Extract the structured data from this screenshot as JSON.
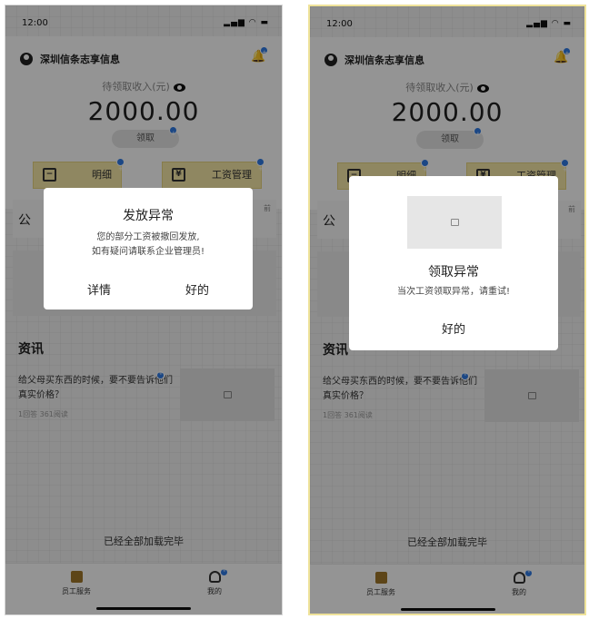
{
  "status": {
    "time": "12:00",
    "signal": "▂▄▆ ◠ ▬"
  },
  "header": {
    "company": "深圳信条志享信息",
    "income_label": "待领取收入(元)",
    "amount": "2000.00",
    "claim_button": "领取"
  },
  "actions": {
    "detail": "明细",
    "detail_icon": "−",
    "salary": "工资管理",
    "salary_icon": "¥"
  },
  "notice": {
    "label": "公",
    "more": "前"
  },
  "news": {
    "section_title": "资讯",
    "article_title": "给父母买东西的时候，要不要告诉他们真实价格？",
    "article_meta": "1回答  361阅读"
  },
  "footer": {
    "loaded_text": "已经全部加载完毕"
  },
  "tabbar": {
    "tab1": "员工服务",
    "tab2": "我的"
  },
  "dialog_left": {
    "title": "发放异常",
    "message_line1": "您的部分工资被撤回发放,",
    "message_line2": "如有疑问请联系企业管理员!",
    "btn_detail": "详情",
    "btn_ok": "好的"
  },
  "dialog_right": {
    "title": "领取异常",
    "message": "当次工资领取异常，请重试!",
    "btn_ok": "好的"
  },
  "colors": {
    "accent_blue": "#2f7be6",
    "action_yellow": "#f6e9a8",
    "overlay": "rgba(0,0,0,0.42)"
  }
}
